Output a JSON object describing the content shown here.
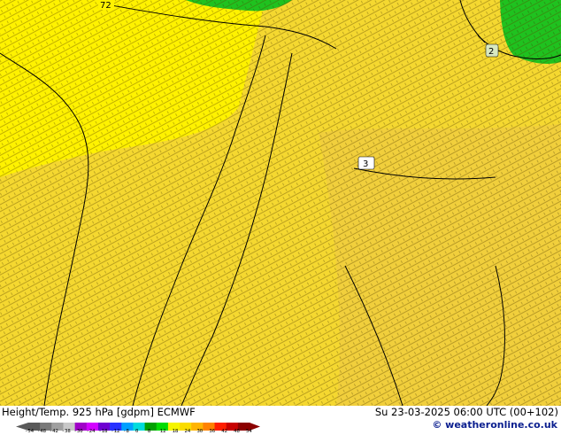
{
  "map": {
    "contour_labels": [
      "72",
      "3",
      "2"
    ],
    "colors": {
      "yellow_bright": "#fff200",
      "yellow": "#f5d830",
      "yellow_mid": "#f1cf3c",
      "green": "#1fc21f",
      "contour": "#000000"
    }
  },
  "footer": {
    "title": "Height/Temp. 925 hPa [gdpm] ECMWF",
    "timestamp": "Su 23-03-2025 06:00 UTC (00+102)",
    "credit": "© weatheronline.co.uk",
    "colorbar": {
      "ticks": [
        "-54",
        "-48",
        "-42",
        "-38",
        "-30",
        "-24",
        "-18",
        "-12",
        "-8",
        "0",
        "8",
        "12",
        "18",
        "24",
        "30",
        "36",
        "42",
        "48",
        "54"
      ],
      "colors": [
        "#5a5a5a",
        "#7a7a7a",
        "#a0a0a0",
        "#c8c8c8",
        "#a000c8",
        "#d200ff",
        "#6e00d2",
        "#2832ff",
        "#00a0ff",
        "#00dcdc",
        "#00a000",
        "#00dc00",
        "#f5f500",
        "#fadc00",
        "#ffb400",
        "#ff8200",
        "#ff1e00",
        "#c80000",
        "#8c0000"
      ]
    }
  }
}
